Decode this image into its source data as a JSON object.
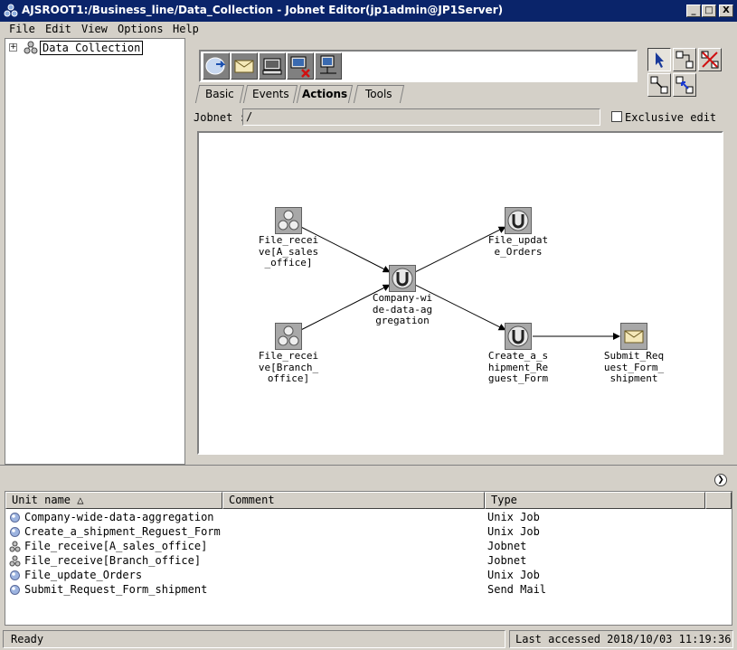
{
  "window": {
    "title": "AJSROOT1:/Business_line/Data_Collection - Jobnet Editor(jp1admin@JP1Server)",
    "min_label": "_",
    "max_label": "□",
    "close_label": "X",
    "title_bar_color": "#0a246a"
  },
  "menu": {
    "items": [
      "File",
      "Edit",
      "View",
      "Options",
      "Help"
    ]
  },
  "tree": {
    "expander": "+",
    "root_label": "Data Collection",
    "root_icon": "jobnet-icon"
  },
  "palette": {
    "icons": [
      "file-receive-icon",
      "mail-icon",
      "pc-job-icon",
      "remove-pc-job-icon",
      "unix-pc-job-icon"
    ]
  },
  "mode_buttons": [
    "select-arrow-icon",
    "connect-icon",
    "disconnect-icon",
    "relation-icon",
    "relation-reverse-icon"
  ],
  "tabs": {
    "items": [
      "Basic",
      "Events",
      "Actions",
      "Tools"
    ],
    "active": "Actions"
  },
  "jobnet_row": {
    "label": "Jobnet :",
    "value": "/",
    "exclusive_edit_label": "Exclusive edit",
    "exclusive_edit_checked": false
  },
  "map": {
    "units": [
      {
        "id": "fr_a",
        "label": "File_recei\nve[A_sales\n_office]",
        "kind": "jobnet"
      },
      {
        "id": "fr_b",
        "label": "File_recei\nve[Branch_\noffice]",
        "kind": "jobnet"
      },
      {
        "id": "agg",
        "label": "Company-wi\nde-data-ag\ngregation",
        "kind": "unix"
      },
      {
        "id": "fu",
        "label": "File_updat\ne_Orders",
        "kind": "unix"
      },
      {
        "id": "cs",
        "label": "Create_a_s\nhipment_Re\nguest_Form",
        "kind": "unix"
      },
      {
        "id": "sr",
        "label": "Submit_Req\nuest_Form_\nshipment",
        "kind": "mail"
      }
    ],
    "edges": [
      {
        "from": "fr_a",
        "to": "agg"
      },
      {
        "from": "fr_b",
        "to": "agg"
      },
      {
        "from": "agg",
        "to": "fu"
      },
      {
        "from": "agg",
        "to": "cs"
      },
      {
        "from": "cs",
        "to": "sr"
      }
    ]
  },
  "list": {
    "collapse_icon": "double-chevron-down-icon",
    "columns": [
      "Unit name △",
      "Comment",
      "Type"
    ],
    "rows": [
      {
        "icon": "unix-job-icon",
        "name": "Company-wide-data-aggregation",
        "comment": "",
        "type": "Unix Job"
      },
      {
        "icon": "unix-job-icon",
        "name": "Create_a_shipment_Reguest_Form",
        "comment": "",
        "type": "Unix Job"
      },
      {
        "icon": "jobnet-icon",
        "name": "File_receive[A_sales_office]",
        "comment": "",
        "type": "Jobnet"
      },
      {
        "icon": "jobnet-icon",
        "name": "File_receive[Branch_office]",
        "comment": "",
        "type": "Jobnet"
      },
      {
        "icon": "unix-job-icon",
        "name": "File_update_Orders",
        "comment": "",
        "type": "Unix Job"
      },
      {
        "icon": "unix-job-icon",
        "name": "Submit_Request_Form_shipment",
        "comment": "",
        "type": "Send Mail"
      }
    ]
  },
  "status": {
    "left": "Ready",
    "right": "Last accessed  2018/10/03 11:19:36"
  }
}
